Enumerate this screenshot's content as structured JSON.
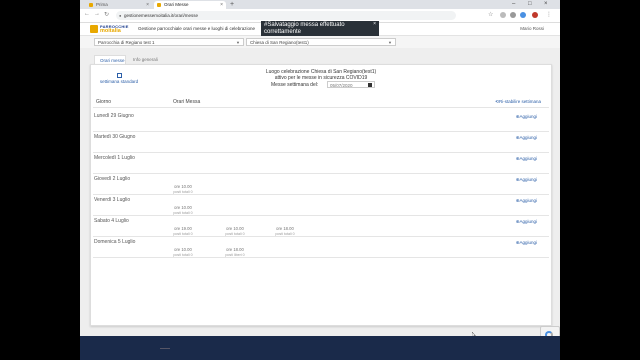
{
  "browser": {
    "tabs": [
      {
        "label": "Prima"
      },
      {
        "label": "Orari Messe"
      }
    ],
    "url": "gestionemessemoitalia.it/orari/messe"
  },
  "site": {
    "logo_line1": "PARROCCHIE",
    "logo_line2": "moitalia",
    "tagline": "Gestione parrocchiale orari messe e luoghi di celebrazione",
    "user": "Mario Rossi"
  },
  "toast": {
    "message": "#Salvataggio messa effettuato correttamente",
    "close": "×"
  },
  "filters": {
    "parish": "Parrocchia di Regiano test 1",
    "church": "Chiesa di San Regiano(test1)"
  },
  "tabs": [
    {
      "label": "Orari messe"
    },
    {
      "label": "Info generali"
    }
  ],
  "card": {
    "standard_week": "settimana standard",
    "title_line1": "Luogo celebrazione Chiesa di San Regiano(test1)",
    "title_line2": "attivo per le messe in sicurezza COVID19",
    "week_label": "Messe settimana del:",
    "week_value": "05/07/2020",
    "col_day": "Giorno",
    "col_times": "Orari Messa",
    "reset": "Ri-stabilire settimana",
    "add_label": "Aggiungi"
  },
  "days": [
    {
      "name": "Lunedì 29 Giugno",
      "slots": []
    },
    {
      "name": "Martedì 30 Giugno",
      "slots": []
    },
    {
      "name": "Mercoledì 1 Luglio",
      "slots": []
    },
    {
      "name": "Giovedì 2 Luglio",
      "slots": [
        {
          "time": "ore 10.00",
          "sub": "posti totali 0"
        }
      ]
    },
    {
      "name": "Venerdì 3 Luglio",
      "slots": [
        {
          "time": "ore 10.00",
          "sub": "posti totali 0"
        }
      ]
    },
    {
      "name": "Sabato 4 Luglio",
      "slots": [
        {
          "time": "ore 19.00",
          "sub": "posti totali 0"
        },
        {
          "time": "ore 10.00",
          "sub": "posti totali 0"
        },
        {
          "time": "ore 18.00",
          "sub": "posti totali 0"
        }
      ]
    },
    {
      "name": "Domenica 5 Luglio",
      "slots": [
        {
          "time": "ore 10.00",
          "sub": "posti totali 0"
        },
        {
          "time": "ore 18.00",
          "sub": "posti liberi 0"
        }
      ]
    }
  ]
}
